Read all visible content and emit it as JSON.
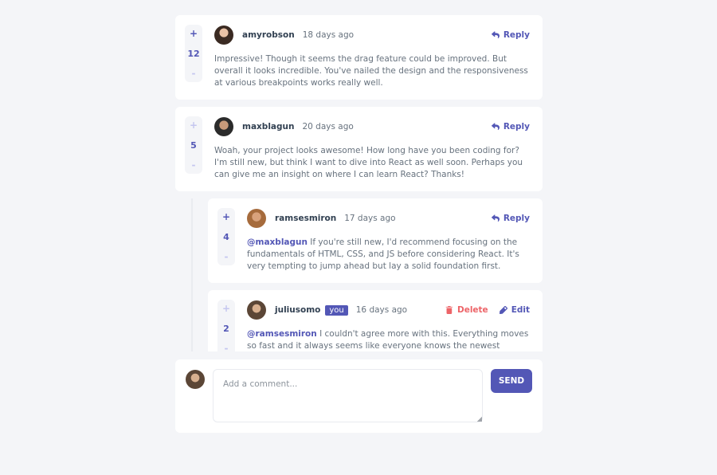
{
  "comments": [
    {
      "username": "amyrobson",
      "date": "18 days ago",
      "score": "12",
      "upvote": "+",
      "downvote": "-",
      "reply_label": "Reply",
      "text": "Impressive! Though it seems the drag feature could be improved. But overall it looks incredible. You've nailed the design and the responsiveness at various breakpoints works really well."
    },
    {
      "username": "maxblagun",
      "date": "20 days ago",
      "score": "5",
      "upvote": "+",
      "downvote": "-",
      "reply_label": "Reply",
      "text": "Woah, your project looks awesome! How long have you been coding for? I'm still new, but think I want to dive into React as well soon. Perhaps you can give me an insight on where I can learn React? Thanks!"
    }
  ],
  "replies": [
    {
      "username": "ramsesmiron",
      "date": "17 days ago",
      "score": "4",
      "upvote": "+",
      "downvote": "-",
      "reply_label": "Reply",
      "mention": "@maxblagun",
      "text": " If you're still new, I'd recommend focusing on the fundamentals of HTML, CSS, and JS before considering React. It's very tempting to jump ahead but lay a solid foundation first."
    },
    {
      "username": "juliusomo",
      "you_badge": "you",
      "date": "16 days ago",
      "score": "2",
      "upvote": "+",
      "downvote": "-",
      "delete_label": "Delete",
      "edit_label": "Edit",
      "mention": "@ramsesmiron",
      "text": " I couldn't agree more with this. Everything moves so fast and it always seems like everyone knows the newest library/framework. But"
    }
  ],
  "composer": {
    "placeholder": "Add a comment...",
    "send_label": "SEND"
  },
  "colors": {
    "accent": "#5357b6",
    "danger": "#ed6468",
    "background": "#f4f5f8",
    "text_dark": "#324152",
    "text_muted": "#67727e"
  },
  "icons": [
    "reply-icon",
    "delete-icon",
    "edit-icon"
  ]
}
